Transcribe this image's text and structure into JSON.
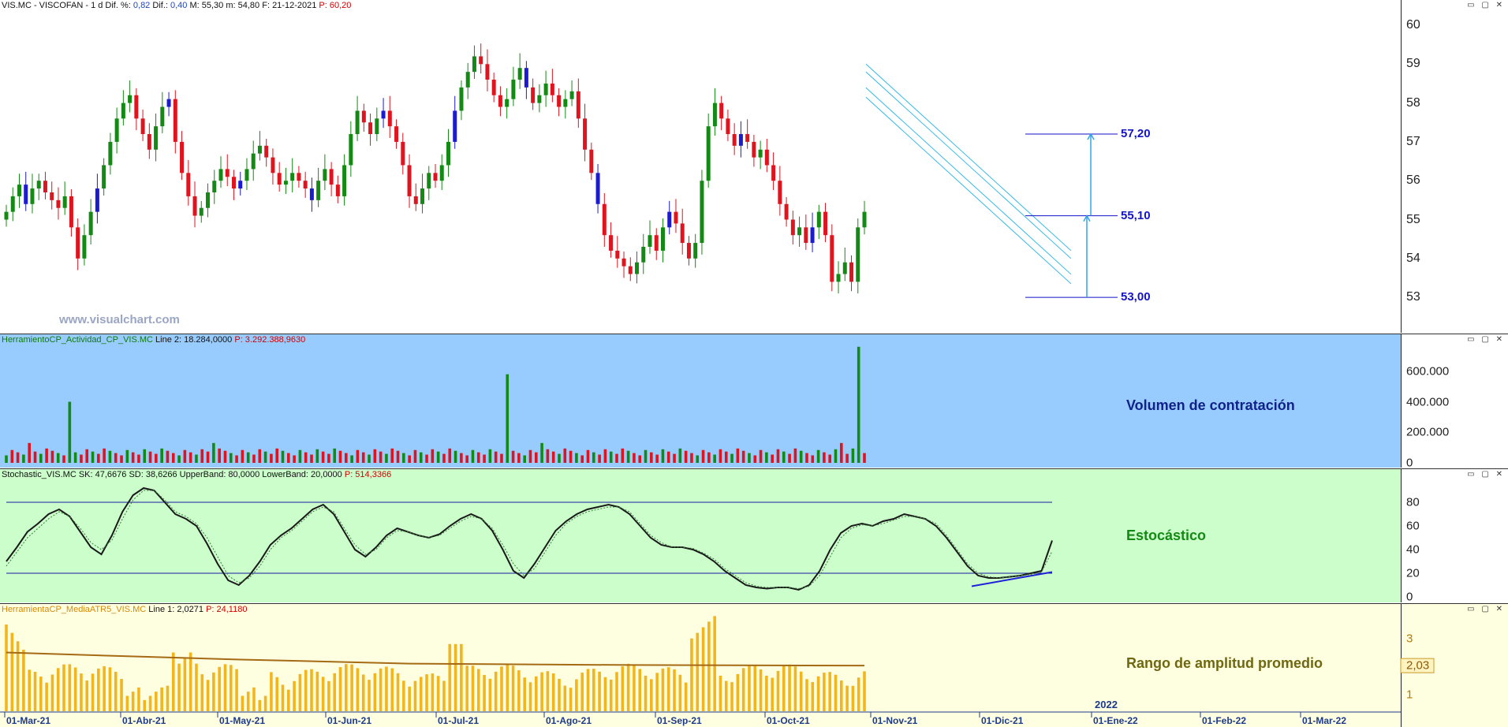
{
  "header": {
    "symbol": "VIS.MC - VISCOFAN - 1 d",
    "dif_pct_label": "Dif. %:",
    "dif_pct_value": "0,82",
    "dif_label": "Dif.:",
    "dif_value": "0,40",
    "max": "M: 55,30",
    "min": "m: 54,80",
    "date": "F: 21-12-2021",
    "price": "P: 60,20"
  },
  "watermark": "www.visualchart.com",
  "window_buttons": "▭ ▢ ✕",
  "price_panel": {
    "y_ticks": [
      "60",
      "59",
      "58",
      "57",
      "56",
      "55",
      "54",
      "53"
    ],
    "levels": [
      {
        "label": "57,20",
        "value": 57.2
      },
      {
        "label": "55,10",
        "value": 55.1
      },
      {
        "label": "53,00",
        "value": 53.0
      }
    ]
  },
  "volume_panel": {
    "header_name": "HerramientoCP_Actividad_CP_VIS.MC",
    "header_line": "Line 2: 18.284,0000",
    "header_p": "P: 3.292.388,9630",
    "title": "Volumen de contratación",
    "y_ticks": [
      "600.000",
      "400.000",
      "200.000",
      "0"
    ]
  },
  "stoch_panel": {
    "header_name": "Stochastic_VIS.MC",
    "header_sk": "SK: 47,6676",
    "header_sd": "SD: 38,6266",
    "header_ub": "UpperBand: 80,0000",
    "header_lb": "LowerBand: 20,0000",
    "header_p": "P: 514,3366",
    "title": "Estocástico",
    "y_ticks": [
      "80",
      "60",
      "40",
      "20",
      "0"
    ]
  },
  "atr_panel": {
    "header_name": "HerramientaCP_MediaATR5_VIS.MC",
    "header_line": "Line 1: 2,0271",
    "header_p": "P: 24,1180",
    "title": "Rango de amplitud promedio",
    "y_ticks": [
      "3",
      "1"
    ],
    "current_value": "2,03",
    "year_marker": "2022"
  },
  "x_labels": [
    "01-Mar-21",
    "01-Abr-21",
    "01-May-21",
    "01-Jun-21",
    "01-Jul-21",
    "01-Ago-21",
    "01-Sep-21",
    "01-Oct-21",
    "01-Nov-21",
    "01-Dic-21",
    "01-Ene-22",
    "01-Feb-22",
    "01-Mar-22"
  ],
  "chart_data": [
    {
      "type": "candlestick",
      "title": "VIS.MC - VISCOFAN - 1 d",
      "ylim": [
        52.8,
        60.3
      ],
      "x_range": [
        "01-Mar-21",
        "21-Dic-21"
      ],
      "colors": {
        "up": "#138a13",
        "down": "#e0141e",
        "doji": "#1b1bd0"
      },
      "horizontal_levels": [
        57.2,
        55.1,
        53.0
      ],
      "descending_channel": {
        "start": "~27-Oct-21",
        "start_upper": 59.0,
        "end": "~21-Dic-21",
        "end_upper": 54.2
      },
      "closes": [
        55.2,
        55.6,
        55.9,
        55.4,
        55.8,
        56.0,
        55.7,
        55.5,
        55.3,
        55.6,
        54.8,
        54.0,
        54.6,
        55.2,
        55.8,
        56.4,
        57.0,
        57.6,
        58.0,
        58.2,
        57.6,
        57.2,
        56.8,
        57.4,
        57.9,
        58.1,
        57.0,
        56.2,
        55.6,
        55.1,
        55.3,
        55.7,
        56.0,
        56.3,
        56.1,
        55.8,
        56.0,
        56.3,
        56.7,
        56.9,
        56.6,
        56.2,
        55.9,
        56.0,
        56.2,
        56.0,
        55.8,
        55.5,
        56.0,
        56.3,
        55.9,
        55.6,
        56.4,
        57.2,
        57.8,
        57.5,
        57.2,
        57.6,
        57.8,
        57.4,
        57.0,
        56.4,
        55.6,
        55.4,
        55.8,
        56.2,
        56.0,
        56.4,
        57.0,
        57.8,
        58.4,
        58.8,
        59.2,
        59.0,
        58.6,
        58.2,
        57.9,
        58.1,
        58.6,
        58.9,
        58.4,
        58.0,
        58.2,
        58.5,
        58.2,
        57.9,
        58.1,
        58.3,
        57.6,
        56.8,
        56.2,
        55.4,
        54.6,
        54.2,
        54.0,
        53.8,
        53.6,
        53.9,
        54.3,
        54.6,
        54.2,
        54.8,
        55.2,
        54.9,
        54.4,
        54.0,
        54.4,
        56.0,
        57.4,
        58.0,
        57.6,
        57.2,
        56.9,
        57.2,
        57.0,
        56.6,
        56.8,
        56.4,
        56.0,
        55.4,
        55.0,
        54.6,
        54.8,
        54.4,
        54.8,
        55.2,
        54.6,
        53.4,
        53.6,
        53.9,
        53.4,
        54.8,
        55.2
      ]
    },
    {
      "type": "bar",
      "title": "Volumen de contratación",
      "ylim": [
        0,
        800000
      ],
      "colors": {
        "up": "#138a13",
        "down": "#e0141e"
      },
      "peaks": [
        {
          "date": "~17-Mar-21",
          "value": 400000
        },
        {
          "date": "~28-Jun-21",
          "value": 580000
        },
        {
          "date": "~20-Dic-21",
          "value": 760000
        }
      ],
      "typical_value": 70000
    },
    {
      "type": "line",
      "title": "Estocástico",
      "ylim": [
        0,
        100
      ],
      "bands": [
        80,
        20
      ],
      "series": [
        {
          "name": "SK",
          "last": 47.6676,
          "color": "#1a1a1a",
          "points": [
            30,
            42,
            55,
            62,
            70,
            74,
            68,
            55,
            42,
            36,
            52,
            72,
            86,
            92,
            90,
            80,
            70,
            66,
            60,
            45,
            28,
            14,
            10,
            18,
            30,
            44,
            52,
            58,
            66,
            74,
            78,
            70,
            55,
            40,
            34,
            42,
            52,
            58,
            55,
            52,
            50,
            53,
            60,
            66,
            70,
            66,
            56,
            40,
            22,
            16,
            28,
            42,
            56,
            64,
            70,
            74,
            76,
            78,
            76,
            70,
            60,
            50,
            44,
            42,
            42,
            40,
            36,
            30,
            22,
            16,
            10,
            8,
            7,
            8,
            8,
            6,
            10,
            22,
            40,
            54,
            60,
            62,
            60,
            64,
            66,
            70,
            68,
            66,
            60,
            50,
            38,
            26,
            18,
            16,
            16,
            17,
            18,
            20,
            22,
            47.7
          ]
        },
        {
          "name": "SD",
          "last": 38.6266,
          "color": "#3a7a3a",
          "points": [
            26,
            38,
            50,
            58,
            66,
            72,
            68,
            58,
            46,
            40,
            48,
            66,
            82,
            90,
            90,
            82,
            72,
            68,
            62,
            50,
            34,
            18,
            12,
            16,
            26,
            40,
            50,
            56,
            64,
            72,
            76,
            72,
            58,
            44,
            36,
            40,
            50,
            56,
            55,
            52,
            50,
            52,
            58,
            64,
            68,
            66,
            58,
            44,
            28,
            18,
            24,
            38,
            52,
            62,
            68,
            72,
            74,
            76,
            76,
            72,
            62,
            52,
            46,
            42,
            42,
            41,
            37,
            32,
            24,
            18,
            12,
            9,
            8,
            8,
            8,
            7,
            9,
            18,
            34,
            50,
            58,
            61,
            60,
            62,
            65,
            68,
            68,
            66,
            62,
            52,
            40,
            28,
            20,
            17,
            16,
            17,
            18,
            19,
            21,
            38.6
          ]
        }
      ]
    },
    {
      "type": "bar",
      "title": "Rango de amplitud promedio",
      "ylim": [
        0.4,
        3.9
      ],
      "colors": {
        "bars": "#f4b51c",
        "average": "#a56a14"
      },
      "average_line": {
        "start": 2.4,
        "end": 2.03
      },
      "current": 2.0271
    }
  ]
}
